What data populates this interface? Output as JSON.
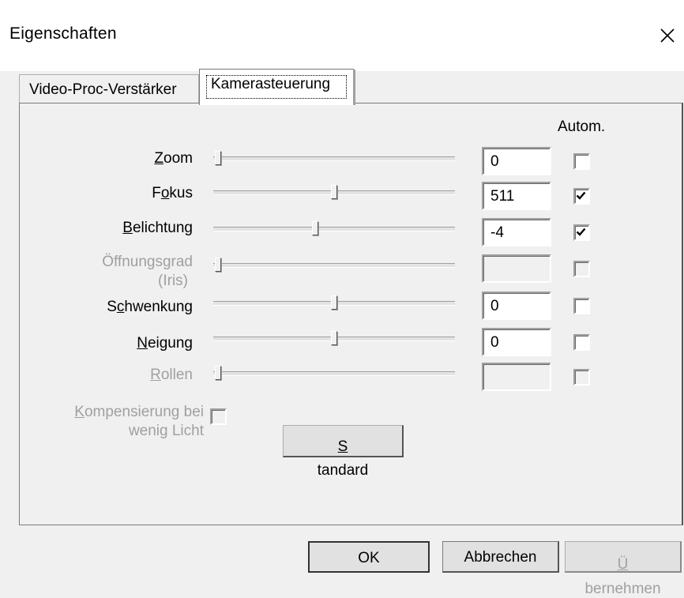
{
  "window": {
    "title": "Eigenschaften",
    "close_glyph": "×"
  },
  "tabs": [
    {
      "label": "Video-Proc-Verstärker",
      "active": false
    },
    {
      "label": "Kamerasteuerung",
      "active": true
    }
  ],
  "auto_header": "Autom.",
  "rows": [
    {
      "label_pre": "",
      "label_ul": "Z",
      "label_post": "oom",
      "value": "0",
      "auto": false,
      "enabled": true,
      "slider_pos": 0.0
    },
    {
      "label_pre": "F",
      "label_ul": "o",
      "label_post": "kus",
      "value": "511",
      "auto": true,
      "enabled": true,
      "slider_pos": 0.5
    },
    {
      "label_pre": "",
      "label_ul": "B",
      "label_post": "elichtung",
      "value": "-4",
      "auto": true,
      "enabled": true,
      "slider_pos": 0.42
    },
    {
      "label_line1": "Öffnungsgrad",
      "label_line2": "(Iris)",
      "value": "",
      "auto": false,
      "enabled": false,
      "slider_pos": 0.0
    },
    {
      "label_pre": "S",
      "label_ul": "c",
      "label_post": "hwenkung",
      "value": "0",
      "auto": false,
      "enabled": true,
      "slider_pos": 0.5
    },
    {
      "label_pre": "",
      "label_ul": "N",
      "label_post": "eigung",
      "value": "0",
      "auto": false,
      "enabled": true,
      "slider_pos": 0.5
    },
    {
      "label_pre": "",
      "label_ul": "R",
      "label_post": "ollen",
      "value": "",
      "auto": false,
      "enabled": false,
      "slider_pos": 0.0
    }
  ],
  "low_light": {
    "line1_ul": "K",
    "line1_rest": "ompensierung bei",
    "line2": "wenig Licht",
    "checked": false,
    "enabled": false
  },
  "buttons": {
    "standard_ul": "S",
    "standard_rest": "tandard",
    "ok": "OK",
    "cancel": "Abbrechen",
    "apply_ul": "Ü",
    "apply_rest": "bernehmen"
  },
  "colors": {
    "window_bg": "#f0f0f0",
    "disabled_text": "#a0a0a0"
  }
}
